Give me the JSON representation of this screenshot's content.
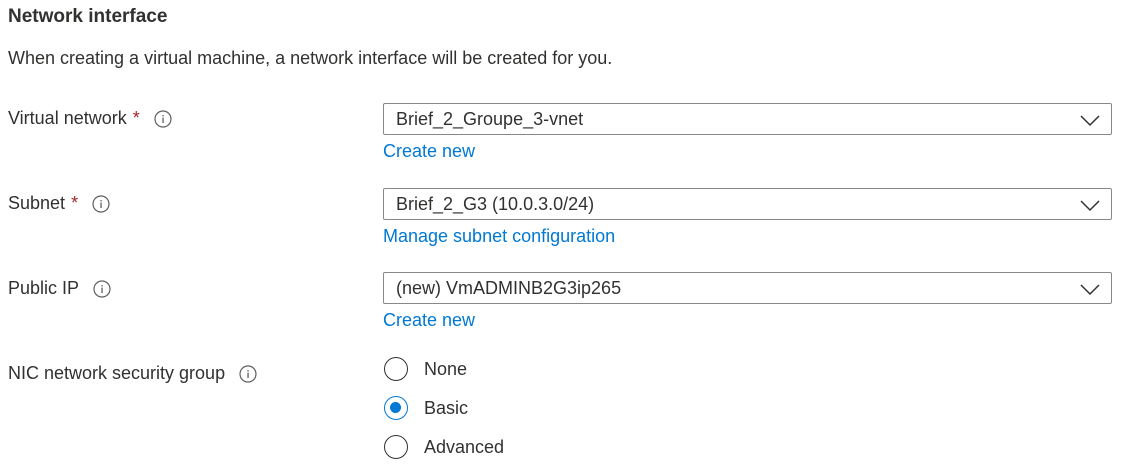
{
  "section": {
    "title": "Network interface",
    "description": "When creating a virtual machine, a network interface will be created for you."
  },
  "fields": {
    "virtual_network": {
      "label": "Virtual network",
      "required_mark": "*",
      "value": "Brief_2_Groupe_3-vnet",
      "link": "Create new"
    },
    "subnet": {
      "label": "Subnet",
      "required_mark": "*",
      "value": "Brief_2_G3 (10.0.3.0/24)",
      "link": "Manage subnet configuration"
    },
    "public_ip": {
      "label": "Public IP",
      "value": "(new) VmADMINB2G3ip265",
      "link": "Create new"
    },
    "nic_nsg": {
      "label": "NIC network security group",
      "options": [
        {
          "label": "None",
          "selected": false
        },
        {
          "label": "Basic",
          "selected": true
        },
        {
          "label": "Advanced",
          "selected": false
        }
      ]
    }
  },
  "icons": {
    "info": "info-icon",
    "dropdown": "chevron-down-icon"
  },
  "colors": {
    "link": "#0078d4",
    "required": "#a4262c",
    "text": "#323130",
    "radio_selected": "#0078d4",
    "border": "#8a8886"
  }
}
